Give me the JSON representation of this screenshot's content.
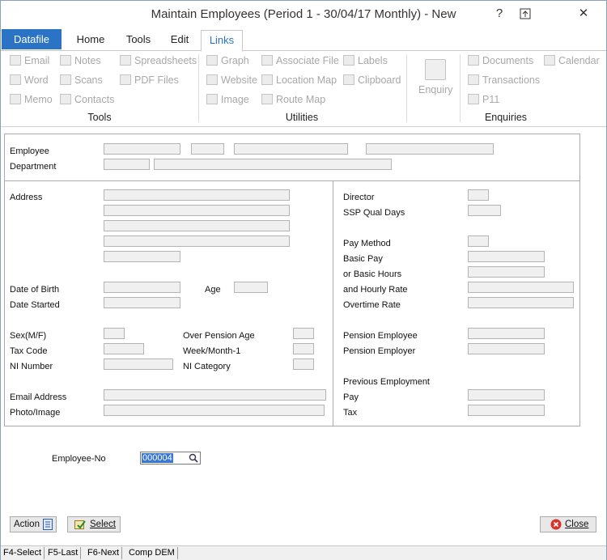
{
  "window": {
    "title": "Maintain Employees  (Period 1 - 30/04/17 Monthly) -  New",
    "controls": {
      "help": "?",
      "restore": "⊡",
      "close": "✕"
    }
  },
  "tabs": [
    "Datafile",
    "Home",
    "Tools",
    "Edit",
    "Links"
  ],
  "active_tab": "Links",
  "ribbon": {
    "tools": {
      "label": "Tools",
      "items": [
        "Email",
        "Word",
        "Memo",
        "Notes",
        "Scans",
        "Contacts"
      ]
    },
    "utilities": {
      "label": "Utilities",
      "items": [
        "Spreadsheets",
        "PDF Files",
        "Graph",
        "Website",
        "Image",
        "Associate File",
        "Location Map",
        "Route Map",
        "Labels",
        "Clipboard"
      ]
    },
    "enquiries": {
      "label": "Enquiries",
      "items": [
        "Enquiry",
        "Documents",
        "Transactions",
        "P11",
        "Calendar"
      ]
    },
    "icons": [
      "mail-icon",
      "word-icon",
      "memo-icon",
      "notes-icon",
      "scans-icon",
      "contacts-icon",
      "spreadsheet-icon",
      "pdf-icon",
      "graph-icon",
      "globe-icon",
      "image-icon",
      "associate-file-icon",
      "location-map-icon",
      "route-map-icon",
      "labels-icon",
      "clipboard-icon",
      "enquiry-icon",
      "documents-icon",
      "transactions-icon",
      "p11-icon",
      "calendar-icon"
    ]
  },
  "form": {
    "employee": "Employee",
    "department": "Department",
    "left": {
      "address": "Address",
      "dob": "Date of Birth",
      "age": "Age",
      "date_started": "Date Started",
      "sex": "Sex(M/F)",
      "over_pension_age": "Over Pension Age",
      "tax_code": "Tax Code",
      "week_month_1": "Week/Month-1",
      "ni_number": "NI Number",
      "ni_category": "NI Category",
      "email": "Email Address",
      "photo": "Photo/Image"
    },
    "right": {
      "director": "Director",
      "ssp_qual_days": "SSP Qual Days",
      "pay_method": "Pay Method",
      "basic_pay": "Basic Pay",
      "basic_hours": "or Basic Hours",
      "hourly_rate": "and Hourly Rate",
      "overtime_rate": "Overtime Rate",
      "pension_employee": "Pension Employee",
      "pension_employer": "Pension Employer",
      "previous_employment": "Previous Employment",
      "pay": "Pay",
      "tax": "Tax"
    }
  },
  "employee_no": {
    "label": "Employee-No",
    "value": "000004"
  },
  "buttons": {
    "action": "Action",
    "select": "Select",
    "close": "Close"
  },
  "status_bar": [
    "F4-Select",
    "F5-Last",
    "F6-Next",
    "Comp DEM"
  ]
}
